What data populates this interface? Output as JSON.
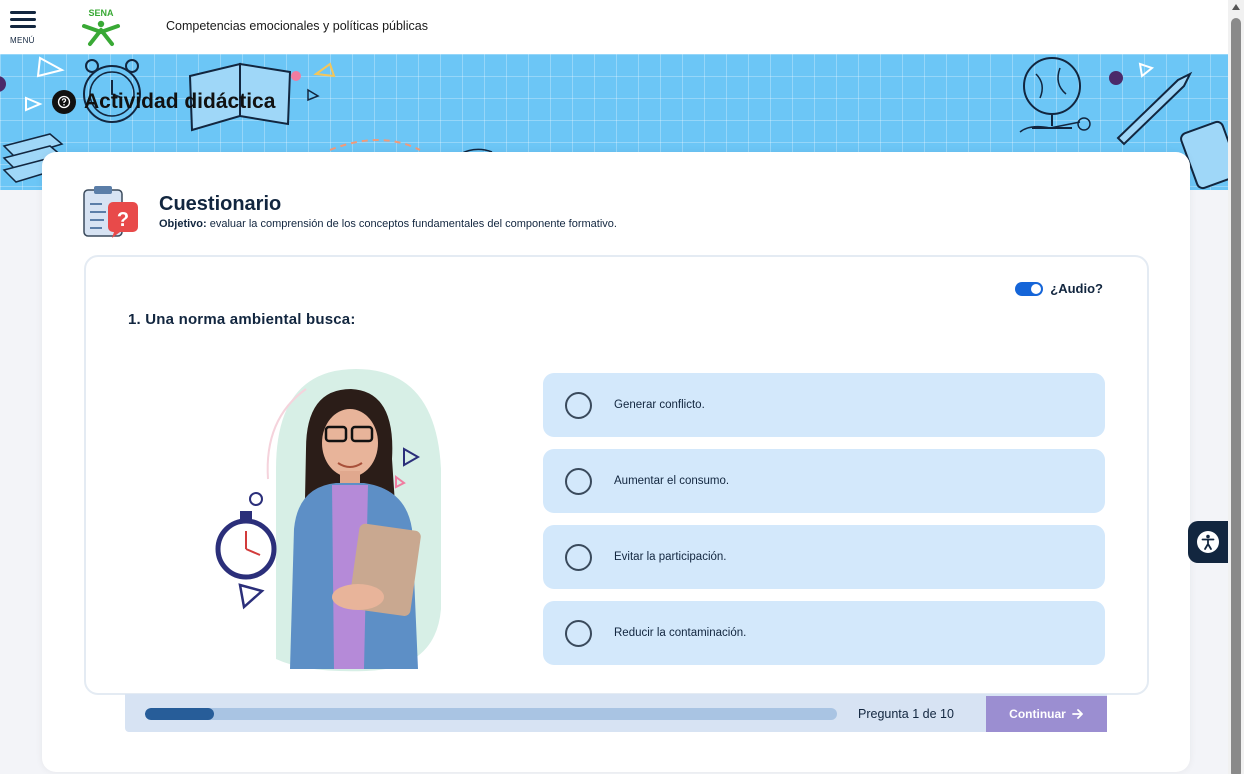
{
  "header": {
    "menu_label": "MENÚ",
    "course_title": "Competencias emocionales y políticas públicas",
    "logo_name": "sena-logo"
  },
  "banner": {
    "title": "Actividad didáctica",
    "bg_color": "#6cc6f6"
  },
  "quiz": {
    "heading": "Cuestionario",
    "objective_label": "Objetivo:",
    "objective_text": " evaluar la comprensión de los conceptos fundamentales del componente formativo.",
    "audio_label": "¿Audio?",
    "audio_enabled": true,
    "question": "1. Una norma ambiental busca:",
    "options": [
      {
        "label": "Generar conflicto.",
        "selected": false
      },
      {
        "label": "Aumentar el consumo.",
        "selected": false
      },
      {
        "label": "Evitar la participación.",
        "selected": false
      },
      {
        "label": "Reducir la contaminación.",
        "selected": false
      }
    ]
  },
  "progress": {
    "text": "Pregunta 1 de 10",
    "current": 1,
    "total": 10,
    "continue_label": "Continuar"
  },
  "colors": {
    "primary": "#12263f",
    "option_bg": "#d3e8fb",
    "progress_fill": "#275d99",
    "continue_bg": "#9b8ed1",
    "toggle": "#1565d8"
  }
}
